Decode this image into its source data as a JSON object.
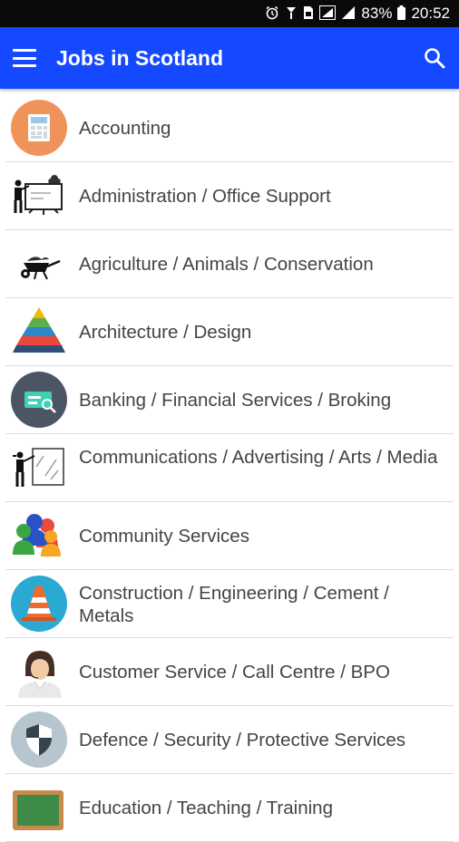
{
  "status_bar": {
    "battery": "83%",
    "time": "20:52"
  },
  "app_bar": {
    "title": "Jobs in Scotland",
    "menu_icon": "hamburger-menu-icon",
    "search_icon": "search-icon",
    "color": "#1449ff"
  },
  "categories": [
    {
      "label": "Accounting",
      "icon": "calculator-icon"
    },
    {
      "label": "Administration / Office Support",
      "icon": "presentation-board-icon"
    },
    {
      "label": "Agriculture / Animals / Conservation",
      "icon": "wheelbarrow-icon"
    },
    {
      "label": "Architecture / Design",
      "icon": "pyramid-icon"
    },
    {
      "label": "Banking / Financial Services / Broking",
      "icon": "bank-card-icon"
    },
    {
      "label": "Communications / Advertising / Arts / Media",
      "icon": "painter-icon"
    },
    {
      "label": "Community Services",
      "icon": "people-icon"
    },
    {
      "label": "Construction / Engineering / Cement / Metals",
      "icon": "traffic-cone-icon"
    },
    {
      "label": "Customer Service / Call Centre / BPO",
      "icon": "call-agent-icon"
    },
    {
      "label": "Defence / Security / Protective Services",
      "icon": "shield-icon"
    },
    {
      "label": "Education / Teaching / Training",
      "icon": "chalkboard-icon"
    }
  ]
}
